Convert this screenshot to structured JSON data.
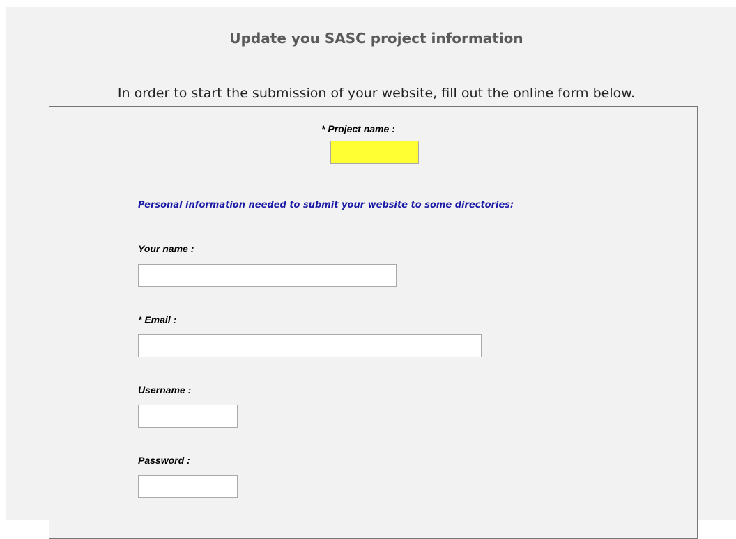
{
  "header": {
    "title": "Update you SASC project information",
    "intro": "In order to start the submission of your website, fill out the online form below."
  },
  "form": {
    "project_name": {
      "label": "* Project name :",
      "value": ""
    },
    "section_note": "Personal information needed to submit your website to some directories:",
    "your_name": {
      "label": "Your name :",
      "value": ""
    },
    "email": {
      "label": "* Email :",
      "value": ""
    },
    "username": {
      "label": "Username :",
      "value": ""
    },
    "password": {
      "label": "Password :",
      "value": ""
    }
  },
  "colors": {
    "required_field_highlight": "#ffff33",
    "section_note_color": "#1a1aa6",
    "title_color": "#5a5a5a"
  }
}
